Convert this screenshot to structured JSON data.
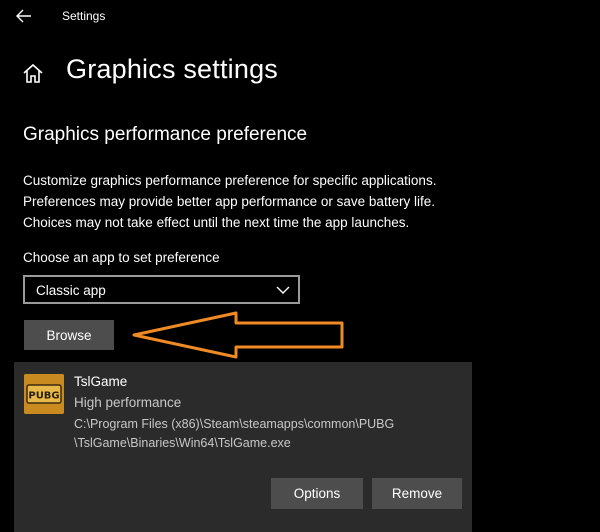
{
  "window": {
    "title": "Settings",
    "back_icon": "arrow-left-icon"
  },
  "header": {
    "home_icon": "home-icon",
    "title": "Graphics settings"
  },
  "section": {
    "title": "Graphics performance preference",
    "description": [
      "Customize graphics performance preference for specific applications.",
      "Preferences may provide better app performance or save battery life.",
      "Choices may not take effect until the next time the app launches."
    ]
  },
  "app_picker": {
    "label": "Choose an app to set preference",
    "selected": "Classic app",
    "browse_label": "Browse"
  },
  "annotation": {
    "arrow_color": "#f08a24"
  },
  "apps": [
    {
      "name": "TslGame",
      "preference": "High performance",
      "path_lines": [
        "C:\\Program Files (x86)\\Steam\\steamapps\\common\\PUBG",
        "\\TslGame\\Binaries\\Win64\\TslGame.exe"
      ],
      "icon_text": "PUBG",
      "options_label": "Options",
      "remove_label": "Remove"
    }
  ],
  "colors": {
    "background": "#000000",
    "card": "#2b2b2b",
    "button": "#4d4d4d",
    "icon_bg": "#c98b1f"
  }
}
